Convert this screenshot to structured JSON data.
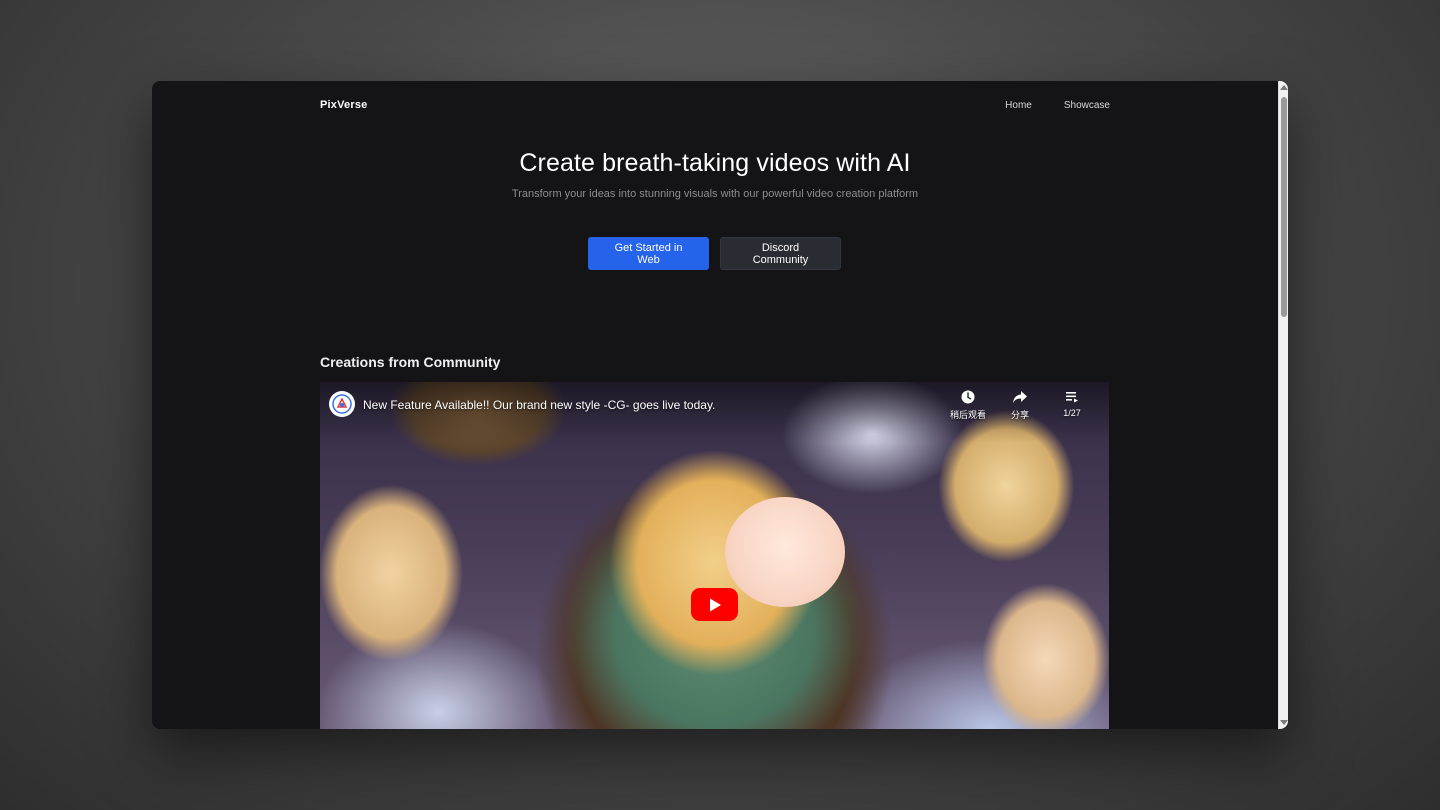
{
  "nav": {
    "logo": "PixVerse",
    "links": [
      "Home",
      "Showcase"
    ]
  },
  "hero": {
    "title": "Create breath-taking videos with AI",
    "subtitle": "Transform your ideas into stunning visuals with our powerful video creation platform",
    "primary_button": "Get Started in Web",
    "secondary_button": "Discord Community"
  },
  "community": {
    "section_title": "Creations from Community",
    "video": {
      "title": "New Feature Available!! Our brand new style -CG- goes live today.",
      "actions": [
        {
          "icon": "clock-icon",
          "label": "稍后观看"
        },
        {
          "icon": "share-icon",
          "label": "分享"
        },
        {
          "icon": "playlist-icon",
          "label": "1/27"
        }
      ]
    }
  },
  "colors": {
    "page_bg": "#141416",
    "primary": "#2563eb",
    "secondary": "#2a2c33",
    "youtube_red": "#ff0000"
  }
}
